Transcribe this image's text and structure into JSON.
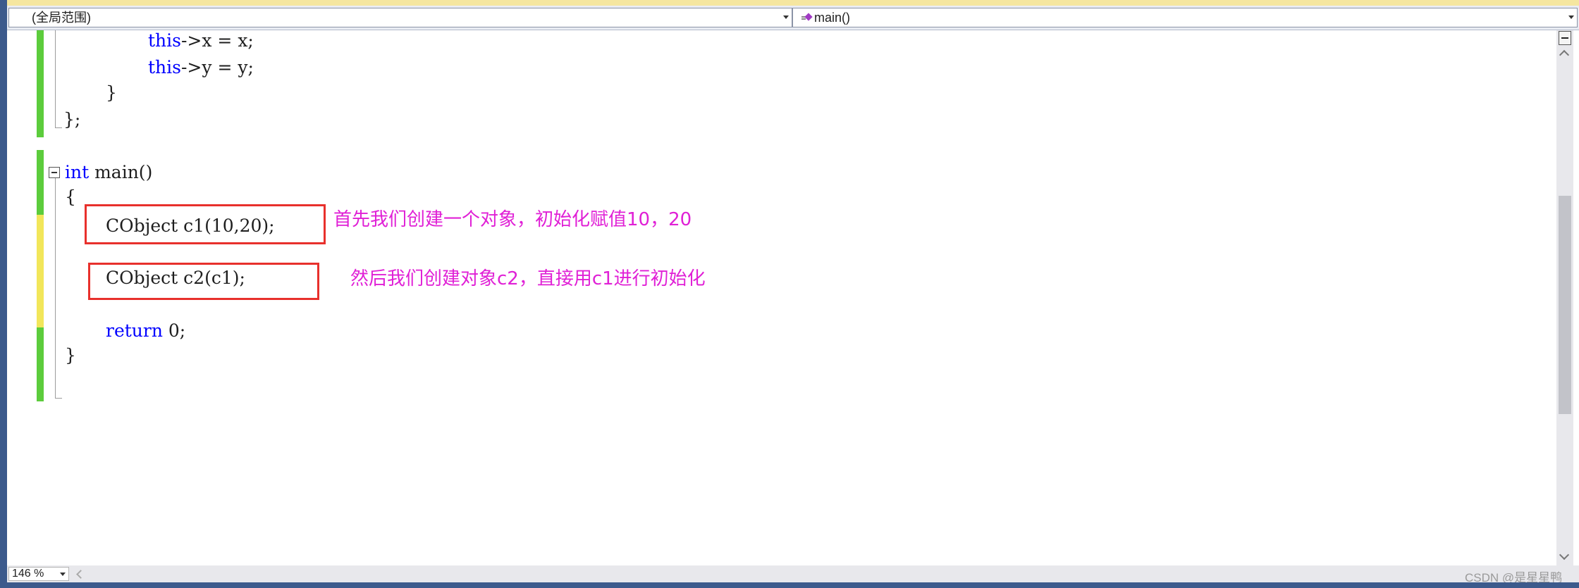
{
  "navigation_bar": {
    "scope_label": "(全局范围)",
    "member_label": "main()",
    "member_icon": "method-icon"
  },
  "code_lines": {
    "l1": {
      "kw": "this",
      "rest": "->x = x;"
    },
    "l2": {
      "kw": "this",
      "rest": "->y = y;"
    },
    "l3": {
      "text": "}"
    },
    "l4": {
      "text": "};"
    },
    "l5": {
      "kw": "int",
      "rest": " main()"
    },
    "l6": {
      "text": "{"
    },
    "l7": {
      "text": "CObject c1(10,20);"
    },
    "l8": {
      "text": "CObject c2(c1);"
    },
    "l9": {
      "kw": "return",
      "rest": " 0;"
    },
    "l10": {
      "text": "}"
    }
  },
  "annotations": {
    "note1": "首先我们创建一个对象，初始化赋值10，20",
    "note2": "然后我们创建对象c2，直接用c1进行初始化"
  },
  "status": {
    "zoom": "146 %",
    "watermark": "CSDN @是星星鸭"
  },
  "colors": {
    "keyword": "#0000ff",
    "annotation": "#e020d6",
    "highlight_box": "#e8302c",
    "saved_change": "#5ccc3c",
    "unsaved_change": "#f2e65a"
  }
}
